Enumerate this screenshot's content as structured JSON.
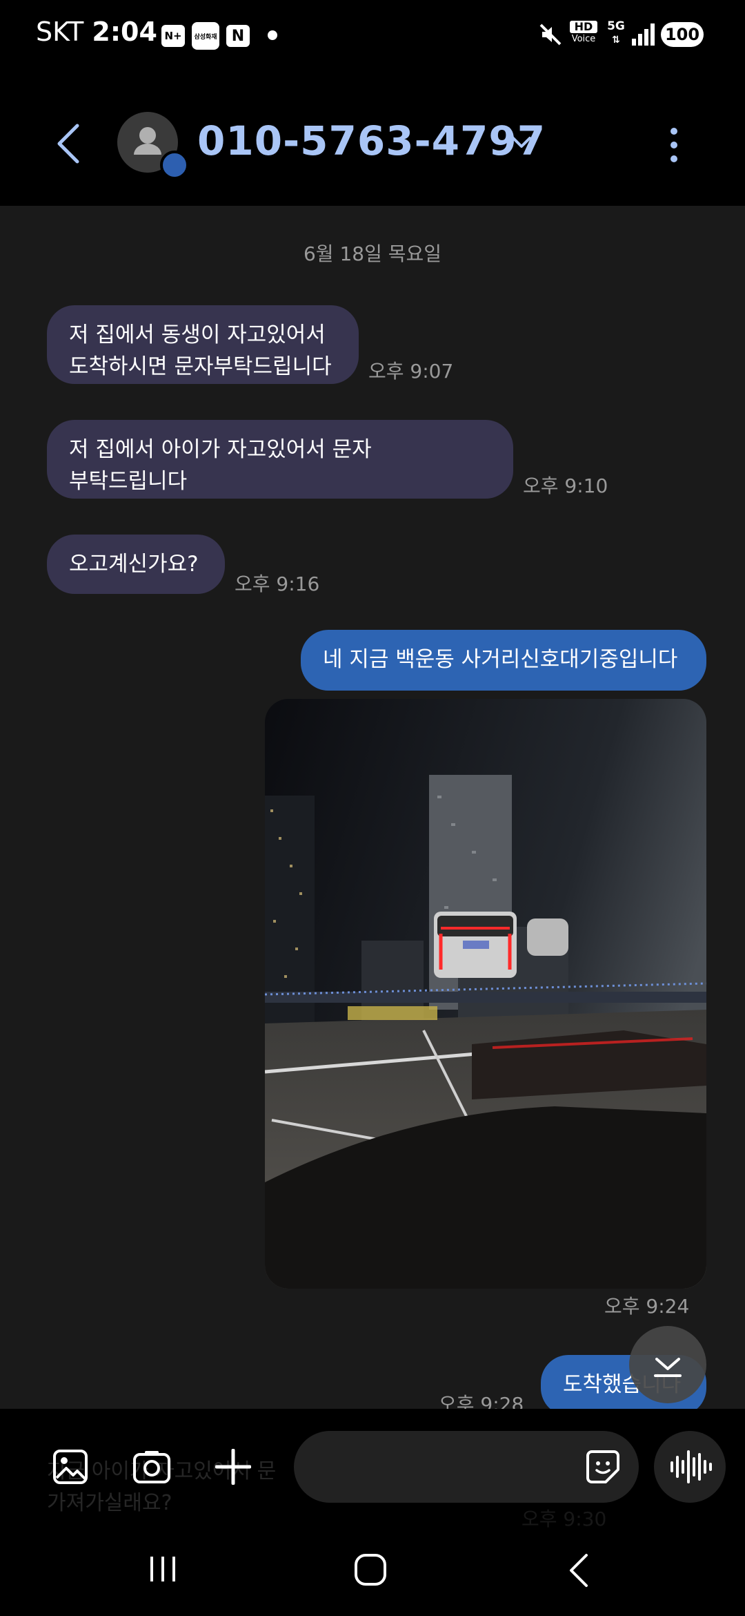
{
  "status_bar": {
    "carrier": "SKT",
    "time": "2:04",
    "notif_icon_2": "삼성화재",
    "notif_icon_3": "N",
    "hd_voice_top": "HD",
    "hd_voice_bottom": "Voice",
    "network": "5G",
    "battery": "100"
  },
  "header": {
    "contact": "010-5763-4797"
  },
  "chat": {
    "date": "6월 18일 목요일",
    "messages": [
      {
        "line1": "저 집에서 동생이 자고있어서",
        "line2": "도착하시면 문자부탁드립니다",
        "time": "오후 9:07"
      },
      {
        "line1": "저 집에서 아이가 자고있어서 문자",
        "line2": "부탁드립니다",
        "time": "오후 9:10"
      },
      {
        "text": "오고계신가요?",
        "time": "오후 9:16"
      },
      {
        "text": "네 지금 백운동 사거리신호대기중입니다"
      },
      {
        "time": "오후 9:24"
      },
      {
        "text": "도착했습니다",
        "time": "오후 9:28"
      }
    ],
    "partial": {
      "line1": "지금 아이가 자고있어서 문",
      "line2": "가져가실래요?",
      "time": "오후 9:30"
    }
  },
  "colors": {
    "incoming_bubble": "#37344f",
    "outgoing_bubble": "#2d64b3",
    "contact_name": "#a9c5f6"
  },
  "icons": [
    "back-arrow-icon",
    "chevron-down-icon",
    "more-vert-icon",
    "gallery-icon",
    "camera-icon",
    "plus-icon",
    "sticker-icon",
    "voice-wave-icon",
    "scroll-down-icon",
    "nav-recents-icon",
    "nav-home-icon",
    "nav-back-icon"
  ]
}
